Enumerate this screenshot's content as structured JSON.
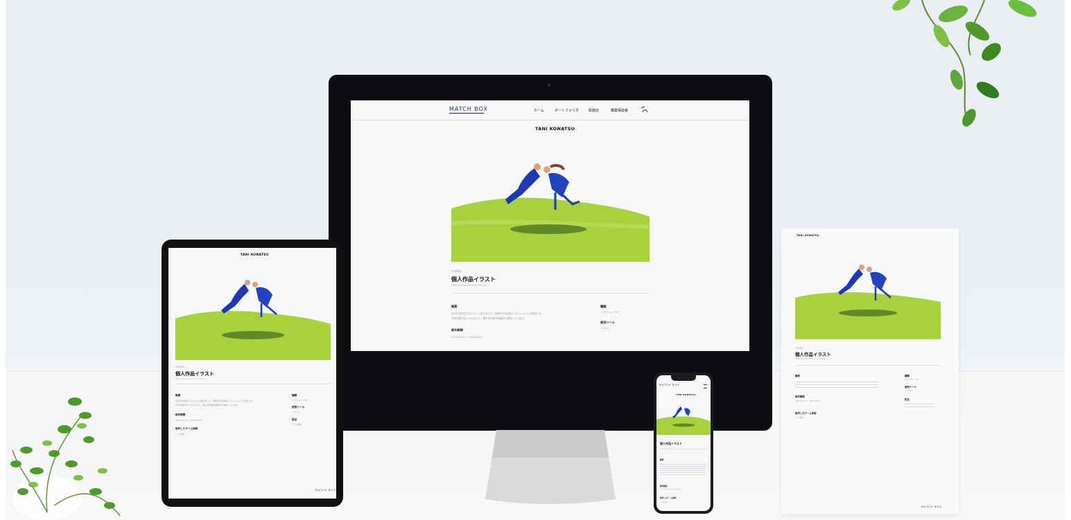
{
  "brand": {
    "logo": "MATCH BOX",
    "accent_blue": "#1f39b5",
    "grass_green": "#a8d13e"
  },
  "desktop": {
    "nav": [
      "ホーム",
      "ポートフォリオ",
      "取扱店",
      "職業相談番"
    ],
    "artist": "TANI KONATSU",
    "category": "イラスト",
    "title": "個人作品イラスト",
    "url": "http://xxxxxxxxxxxxxxxx.xxx",
    "section_overview": "概要",
    "overview_lines": [
      "自分の作品をさらにもっと描きました。色鮮やかな色彩にチャレンジした作品です。",
      "作家の魅力をいかせるよう、様々な作風を積極的に発信しています。"
    ],
    "section_period": "制作期間",
    "period": "2024.04.01 〜 2024.08.01",
    "side_label_1": "種類",
    "side_value_1": "イラストレーター",
    "side_label_2": "使用ツール",
    "side_value_2": "イラスト"
  },
  "tablet": {
    "artist": "TANI KONATSU",
    "category": "イラスト",
    "title": "個人作品イラスト",
    "url": "http://xxxxxxxxxxxxxxxx.xxx",
    "section_overview": "概要",
    "overview_lines": [
      "自分の作品をさらにもっと描きました。色鮮やかな色彩にチャレンジした作品です。",
      "作家の魅力をいかせるよう、様々な作風を積極的に発信しています。"
    ],
    "section_period": "制作期間",
    "period": "2024.04.01 〜 2024.08.01",
    "section_team": "制作したチーム体制",
    "team": "ー 2 名等",
    "side_label_1": "種類",
    "side_value_1": "イラストレーター",
    "side_label_2": "使用ツール",
    "side_value_2": "イラスト",
    "side_label_3": "担当",
    "side_value_3": "ー 1 名等",
    "footer_logo": "MATCH BOX"
  },
  "phone": {
    "logo": "MATCH BOX",
    "artist": "TANI KONATSU",
    "title": "個人作品イラスト",
    "section_overview": "概要",
    "section_period": "制作期間",
    "section_team": "制作したチーム体制",
    "team": "ー 2 名等"
  },
  "sheet": {
    "artist": "TANI KONATSU",
    "category": "イラスト",
    "title": "個人作品イラスト",
    "url": "http://xxxxxxxxxxxxxxxx.xxx",
    "section_overview": "概要",
    "section_period": "制作期間",
    "period": "2024.04.01 〜 2024.08.01",
    "section_team": "制作したチーム体制",
    "team": "ー 2 名等",
    "side_label_1": "種類",
    "side_value_1": "イラストレーター",
    "side_label_2": "使用ツール",
    "side_value_2": "イラスト",
    "side_label_3": "担当",
    "footer_logo": "MATCH BOX"
  }
}
